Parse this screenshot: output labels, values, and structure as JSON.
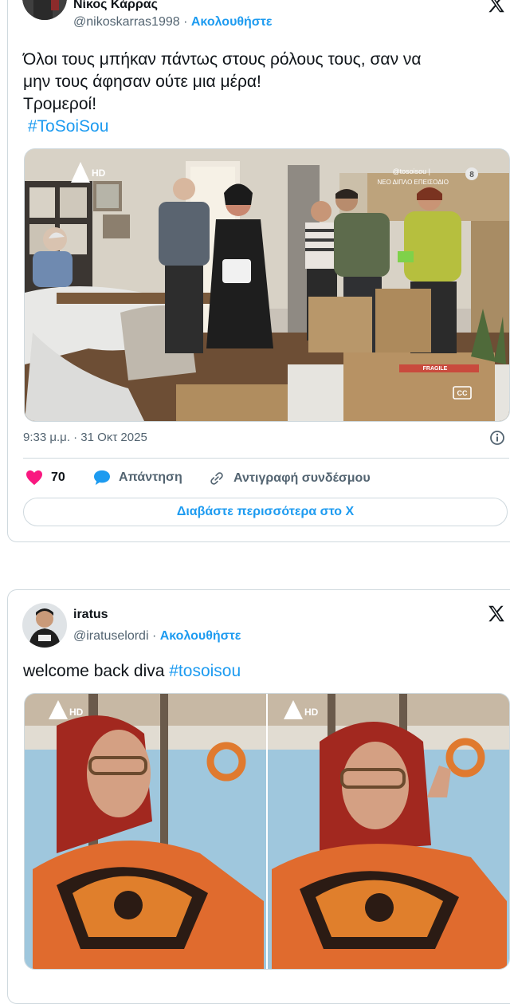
{
  "tweets": [
    {
      "author_name": "Νίκος Κάρρας",
      "handle": "@nikoskarras1998",
      "separator": "·",
      "follow_label": "Ακολουθήστε",
      "text_lines": [
        "Όλοι τους μπήκαν πάντως στους ρόλους τους, σαν να",
        "μην τους άφησαν ούτε μια μέρα!",
        "Τρομεροί!"
      ],
      "hashtag": "#ToSoiSou",
      "media_overlay": {
        "channel_logo": "HD",
        "watermark": "@tosoisou |",
        "watermark_badge": "8",
        "episode_label": "ΝΕΟ ΔΙΠΛΟ ΕΠΕΙΣΟΔΙΟ",
        "cc_label": "CC",
        "tape_text": "FRAGILE"
      },
      "timestamp": "9:33 μ.μ. · 31 Οκτ 2025",
      "likes": "70",
      "reply_label": "Απάντηση",
      "copy_link_label": "Αντιγραφή συνδέσμου",
      "read_more_label": "Διαβάστε περισσότερα στο X"
    },
    {
      "author_name": "iratus",
      "handle": "@iratuselordi",
      "separator": "·",
      "follow_label": "Ακολουθήστε",
      "text": "welcome back diva ",
      "hashtag": "#tosoisou",
      "media_overlay": {
        "channel_logo": "HD"
      }
    }
  ],
  "colors": {
    "accent": "#1d9bf0",
    "like": "#f91880",
    "secondary_text": "#536471",
    "border": "#cfd9de"
  },
  "icons": [
    "x-logo-icon",
    "heart-icon",
    "reply-bubble-icon",
    "link-icon",
    "info-icon"
  ]
}
